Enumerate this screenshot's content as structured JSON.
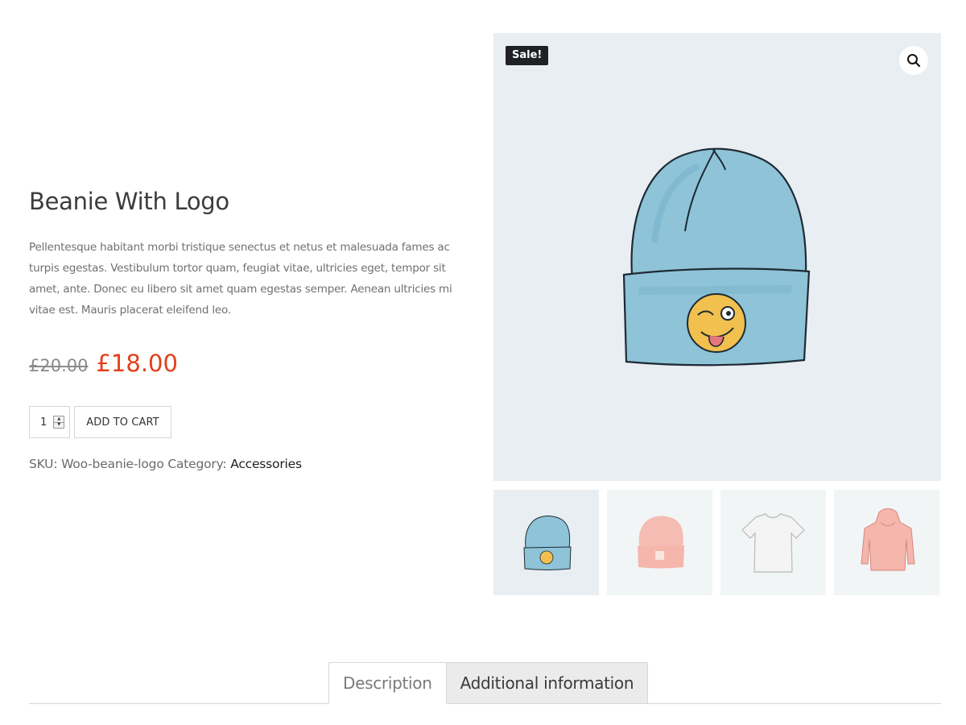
{
  "product": {
    "title": "Beanie With Logo",
    "description": "Pellentesque habitant morbi tristique senectus et netus et malesuada fames ac turpis egestas. Vestibulum tortor quam, feugiat vitae, ultricies eget, tempor sit amet, ante. Donec eu libero sit amet quam egestas semper. Aenean ultricies mi vitae est. Mauris placerat eleifend leo.",
    "price_regular": "£20.00",
    "price_sale": "£18.00",
    "quantity": "1",
    "add_to_cart_label": "ADD TO CART",
    "sku_label": "SKU:",
    "sku_value": "Woo-beanie-logo",
    "category_label": "Category:",
    "category_value": "Accessories"
  },
  "gallery": {
    "sale_badge": "Sale!",
    "zoom_icon": "search-icon",
    "main_image": "blue-beanie-with-winking-emoji-logo",
    "thumbnails": [
      {
        "image": "blue-beanie-with-logo",
        "active": true
      },
      {
        "image": "pink-beanie",
        "active": false
      },
      {
        "image": "white-t-shirt",
        "active": false
      },
      {
        "image": "pink-hoodie",
        "active": false
      }
    ]
  },
  "tabs": [
    {
      "label": "Description",
      "active": true
    },
    {
      "label": "Additional information",
      "active": false
    }
  ],
  "colors": {
    "sale_price": "#e2401c",
    "badge_bg": "#1f2124",
    "image_bg": "#e8eef1",
    "beanie_blue": "#8fc3d9",
    "pink": "#f5b6ac"
  }
}
